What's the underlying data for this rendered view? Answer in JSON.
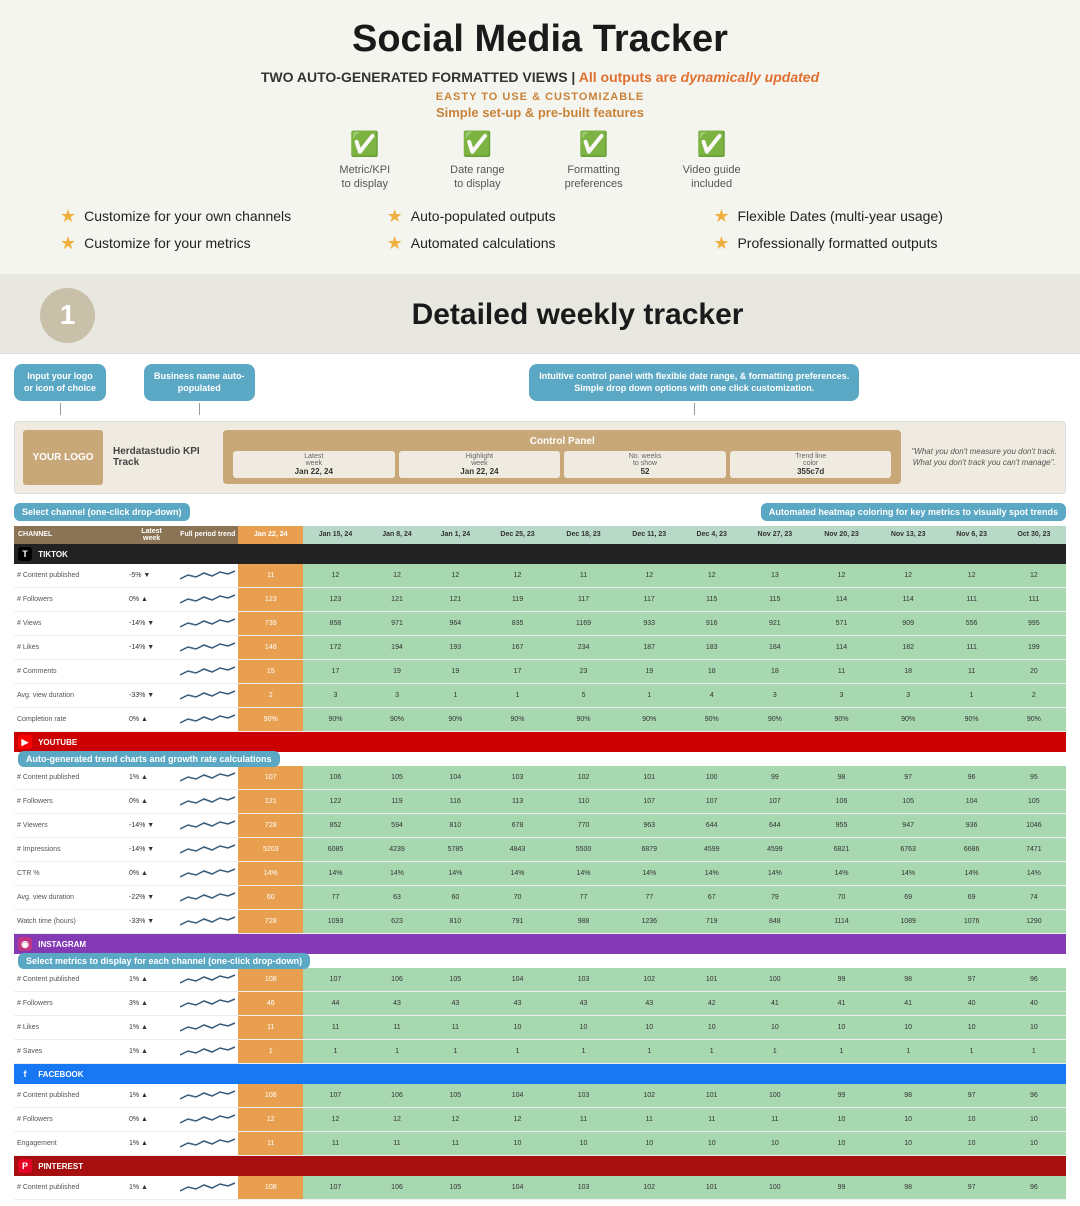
{
  "header": {
    "title": "Social Media Tracker",
    "subtitle": "TWO AUTO-GENERATED FORMATTED  VIEWS | ",
    "subtitle_highlight": "All outputs are ",
    "subtitle_italic": "dynamically updated",
    "easy_label": "EASTY TO USE & CUSTOMIZABLE",
    "simple_label": "Simple set-up & pre-built features"
  },
  "icons": [
    {
      "label": "Metric/KPI\nto display"
    },
    {
      "label": "Date range\nto display"
    },
    {
      "label": "Formatting\npreferences"
    },
    {
      "label": "Video guide\nincluded"
    }
  ],
  "bullets": [
    "Customize for your own channels",
    "Auto-populated outputs",
    "Flexible Dates (multi-year usage)",
    "Customize for your metrics",
    "Automated calculations",
    "Professionally formatted outputs"
  ],
  "section2": {
    "number": "1",
    "title": "Detailed weekly tracker"
  },
  "annotations": {
    "logo": "Input your logo\nor icon of choice",
    "business": "Business name auto-\npopulated",
    "control": "Intuitive control panel with flexible date range, & formatting preferences.\nSimple drop down options with one click customization.",
    "channel_select": "Select channel (one-click drop-down)",
    "heatmap": "Automated heatmap coloring for key metrics to visually spot trends",
    "trend_charts": "Auto-generated trend charts and growth rate calculations",
    "metrics_select": "Select metrics to display for each channel (one-click drop-down)"
  },
  "control_panel": {
    "title": "Control Panel",
    "business_name": "Herdatastudio KPI Track",
    "fields": [
      {
        "label": "Latest\nweek",
        "value": "Jan 22, 24"
      },
      {
        "label": "Highlight\nweek",
        "value": "Jan 22, 24"
      },
      {
        "label": "No. weeks\nto show",
        "value": "52"
      },
      {
        "label": "Trend line\ncolor",
        "value": "355c7d"
      }
    ],
    "quote": "\"What you don't measure you don't track.\nWhat you don't track you can't manage\"."
  },
  "table_headers": [
    "CHANNEL",
    "Latest\nweek",
    "Full period trend",
    "Jan 22, 24",
    "Jan 15, 24",
    "Jan 8, 24",
    "Jan 1, 24",
    "Dec 25, 23",
    "Dec 18, 23",
    "Dec 11, 23",
    "Dec 4, 23",
    "Nov 27, 23",
    "Nov 20, 23",
    "Nov 13, 23",
    "Nov 6, 23",
    "Oct 30, 23"
  ],
  "channels": [
    {
      "name": "TIKTOK",
      "icon": "T",
      "color": "tiktok",
      "metrics": [
        {
          "name": "# Content published",
          "change": "-5%",
          "dir": "neg",
          "values": [
            11,
            12,
            12,
            12,
            12,
            11,
            12,
            12,
            13,
            12,
            12,
            12,
            12
          ]
        },
        {
          "name": "# Followers",
          "change": "0%",
          "dir": "zero",
          "values": [
            123,
            123,
            121,
            121,
            119,
            117,
            117,
            115,
            115,
            114,
            114,
            111,
            111
          ]
        },
        {
          "name": "# Views",
          "change": "-14%",
          "dir": "neg",
          "values": [
            739,
            858,
            971,
            964,
            835,
            1169,
            933,
            916,
            921,
            571,
            909,
            556,
            995
          ]
        },
        {
          "name": "# Likes",
          "change": "-14%",
          "dir": "neg",
          "values": [
            148,
            172,
            194,
            193,
            167,
            234,
            187,
            183,
            184,
            114,
            182,
            111,
            199
          ]
        },
        {
          "name": "# Comments",
          "change": "",
          "dir": "zero",
          "values": [
            15,
            17,
            19,
            19,
            17,
            23,
            19,
            18,
            18,
            11,
            18,
            11,
            20
          ]
        },
        {
          "name": "Avg. view duration",
          "change": "-33%",
          "dir": "neg",
          "values": [
            2.0,
            3.0,
            3.0,
            1.0,
            1.0,
            5.0,
            1.0,
            4.0,
            3.0,
            3.0,
            3.0,
            1.0,
            2.0
          ]
        },
        {
          "name": "Completion rate",
          "change": "0%",
          "dir": "zero",
          "values": [
            "90%",
            "90%",
            "90%",
            "90%",
            "90%",
            "90%",
            "90%",
            "90%",
            "90%",
            "90%",
            "90%",
            "90%",
            "90%"
          ]
        }
      ]
    },
    {
      "name": "YOUTUBE",
      "icon": "▶",
      "color": "youtube",
      "metrics": [
        {
          "name": "# Content published",
          "change": "1%",
          "dir": "pos",
          "values": [
            107,
            106,
            105,
            104,
            103,
            102,
            101,
            100,
            99,
            98,
            97,
            96,
            95
          ]
        },
        {
          "name": "# Followers",
          "change": "0%",
          "dir": "zero",
          "values": [
            121,
            122,
            119,
            116,
            113,
            110,
            107,
            107,
            107,
            106,
            105,
            104,
            105
          ]
        },
        {
          "name": "# Viewers",
          "change": "-14%",
          "dir": "neg",
          "values": [
            728,
            852,
            594,
            810,
            678,
            770,
            963,
            644,
            644,
            955,
            947,
            936,
            1046
          ]
        },
        {
          "name": "# Impressions",
          "change": "-14%",
          "dir": "neg",
          "values": [
            5203,
            6085,
            4239,
            5785,
            4843,
            5500,
            6879,
            4599,
            4599,
            6821,
            6763,
            6686,
            7471
          ]
        },
        {
          "name": "CTR %",
          "change": "0%",
          "dir": "pos",
          "values": [
            "14%",
            "14%",
            "14%",
            "14%",
            "14%",
            "14%",
            "14%",
            "14%",
            "14%",
            "14%",
            "14%",
            "14%",
            "14%"
          ]
        },
        {
          "name": "Avg. view duration",
          "change": "-22%",
          "dir": "neg",
          "values": [
            60.0,
            77.0,
            63.0,
            60.0,
            70.0,
            77.0,
            77.0,
            67.0,
            79.0,
            70.0,
            69.0,
            69.0,
            74.0
          ]
        },
        {
          "name": "Watch time (hours)",
          "change": "-33%",
          "dir": "neg",
          "values": [
            728,
            1093,
            623,
            810,
            791,
            988,
            1236,
            719,
            848,
            1114,
            1089,
            1076,
            1290
          ]
        }
      ]
    },
    {
      "name": "INSTAGRAM",
      "icon": "◉",
      "color": "instagram",
      "metrics": [
        {
          "name": "# Content published",
          "change": "1%",
          "dir": "pos",
          "values": [
            108,
            107,
            106,
            105,
            104,
            103,
            102,
            101,
            100,
            99,
            98,
            97,
            96
          ]
        },
        {
          "name": "# Followers",
          "change": "3%",
          "dir": "pos",
          "values": [
            46,
            44,
            43,
            43,
            43,
            43,
            43,
            42,
            41,
            41,
            41,
            40,
            40
          ]
        },
        {
          "name": "# Likes",
          "change": "1%",
          "dir": "pos",
          "values": [
            11,
            11,
            11,
            11,
            10,
            10,
            10,
            10,
            10,
            10,
            10,
            10,
            10
          ]
        },
        {
          "name": "# Saves",
          "change": "1%",
          "dir": "pos",
          "values": [
            1,
            1,
            1,
            1,
            1,
            1,
            1,
            1,
            1,
            1,
            1,
            1,
            1
          ]
        }
      ]
    },
    {
      "name": "FACEBOOK",
      "icon": "f",
      "color": "facebook",
      "metrics": [
        {
          "name": "# Content published",
          "change": "1%",
          "dir": "pos",
          "values": [
            108,
            107,
            106,
            105,
            104,
            103,
            102,
            101,
            100,
            99,
            98,
            97,
            96
          ]
        },
        {
          "name": "# Followers",
          "change": "0%",
          "dir": "zero",
          "values": [
            12,
            12,
            12,
            12,
            12,
            11,
            11,
            11,
            11,
            10,
            10,
            10,
            10
          ]
        },
        {
          "name": "Engagement",
          "change": "1%",
          "dir": "pos",
          "values": [
            11,
            11,
            11,
            11,
            10,
            10,
            10,
            10,
            10,
            10,
            10,
            10,
            10
          ]
        }
      ]
    },
    {
      "name": "PINTEREST",
      "icon": "P",
      "color": "pinterest",
      "metrics": [
        {
          "name": "# Content published",
          "change": "1%",
          "dir": "pos",
          "values": [
            108,
            107,
            106,
            105,
            104,
            103,
            102,
            101,
            100,
            99,
            98,
            97,
            96
          ]
        }
      ]
    }
  ]
}
